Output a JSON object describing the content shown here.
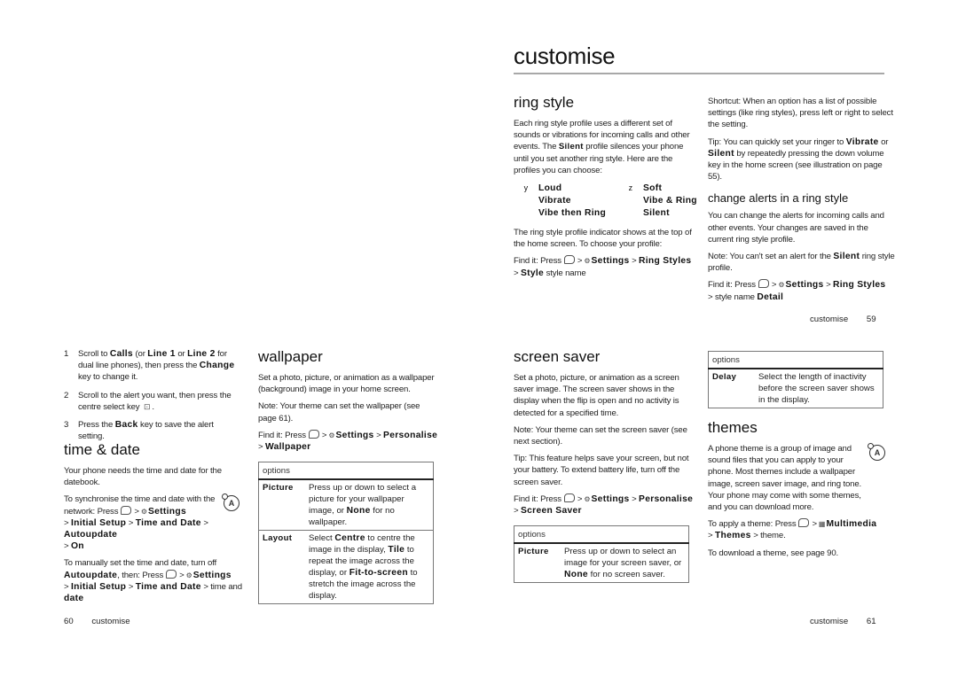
{
  "page_right_top": {
    "title": "customise",
    "ring_style": {
      "heading": "ring style",
      "intro_pre": "Each ring style profile uses a different set of sounds or vibrations for incoming calls and other events. The ",
      "intro_bold": "Silent",
      "intro_post": " profile silences your phone until you set another ring style. Here are the profiles you can choose:",
      "profiles": [
        {
          "marker": "y",
          "label": "Loud"
        },
        {
          "marker": "z",
          "label": "Soft"
        },
        {
          "marker": "",
          "label": "Vibrate"
        },
        {
          "marker": "",
          "label": "Vibe & Ring"
        },
        {
          "marker": "",
          "label": "Vibe then Ring"
        },
        {
          "marker": "",
          "label": "Silent"
        }
      ],
      "indicator_text": "The ring style profile indicator shows at the top of the home screen. To choose your profile:",
      "find_it": {
        "prefix": "Find it:  Press",
        "sep": ">",
        "settings": "Settings",
        "path1": "Ring Styles",
        "path2": "Style",
        "tail": "style name"
      }
    },
    "shortcut": "Shortcut:  When an option has a list of possible settings (like ring styles), press left or right to select the setting.",
    "tip": {
      "pre": "Tip:  You can quickly set your ringer to ",
      "b1": "Vibrate",
      "mid": " or ",
      "b2": "Silent",
      "post": " by repeatedly pressing the down volume key in the home screen (see illustration on page 55)."
    },
    "change_alerts": {
      "heading": "change alerts in a ring style",
      "body": "You can change the alerts for incoming calls and other events. Your changes are saved in the current ring style profile.",
      "note_pre": "Note:  You can't set an alert for the ",
      "note_bold": "Silent",
      "note_post": " ring style profile.",
      "find_it": {
        "prefix": "Find it:  Press",
        "sep": ">",
        "settings": "Settings",
        "path1": "Ring Styles",
        "tail": "style name",
        "path2": "Detail"
      }
    },
    "footer": {
      "label": "customise",
      "page": "59"
    }
  },
  "page_left_bottom": {
    "steps": [
      {
        "n": "1",
        "pre": "Scroll to ",
        "b1": "Calls",
        "m1": " (or ",
        "b2": "Line 1",
        "m2": " or ",
        "b3": "Line 2",
        "m3": " for dual line phones), then press the ",
        "b4": "Change",
        "post": " key to change it."
      },
      {
        "n": "2",
        "text": "Scroll to the alert you want, then press the centre select key",
        "icon": "⊡"
      },
      {
        "n": "3",
        "pre": "Press the ",
        "b1": "Back",
        "post": " key to save the alert setting."
      }
    ],
    "time_date": {
      "heading": "time & date",
      "body": "Your phone needs the time and date for the datebook.",
      "sync_pre": "To synchronise  the time and date with the network: Press",
      "settings": "Settings",
      "sync_path": [
        "Initial Setup",
        "Time and Date",
        "Autoupdate",
        "On"
      ],
      "manual_pre": "To manually  set the time and date, turn off ",
      "manual_bold": "Autoupdate",
      "manual_mid": ", then: Press",
      "manual_path": [
        "Initial Setup",
        "Time and Date",
        "time",
        "date"
      ],
      "sep": ">"
    },
    "wallpaper": {
      "heading": "wallpaper",
      "body": "Set a photo, picture,  or animation as a wallpaper (background) image in your home screen.",
      "note": "Note:  Your theme can set the wallpaper (see page 61).",
      "find_prefix": "Find it:  Press",
      "settings": "Settings",
      "path": [
        "Personalise",
        "Wallpaper"
      ],
      "sep": ">",
      "table": {
        "header": "options",
        "rows": [
          {
            "key": "Picture",
            "desc_pre": "Press     up or down to select a picture for your wallpaper image, or ",
            "desc_bold": "None",
            "desc_post": " for no wallpaper."
          },
          {
            "key": "Layout",
            "desc_pre": "Select ",
            "b1": "Centre",
            "m1": " to centre the image in the display, ",
            "b2": "Tile",
            "m2": " to repeat the image across the display, or ",
            "b3": "Fit-to-screen",
            "post": " to stretch the image across the display."
          }
        ]
      }
    },
    "footer": {
      "page": "60",
      "label": "customise"
    }
  },
  "page_right_bottom": {
    "screen_saver": {
      "heading": "screen saver",
      "body": "Set a photo, picture, or animation as a screen saver image. The screen saver shows in the display when the flip is open and no activity is detected for a specified time.",
      "note": "Note:  Your theme can set the screen saver (see next section).",
      "tip": "Tip:  This feature helps save your screen, but not your battery. To extend battery life, turn off the screen saver.",
      "find_prefix": "Find it:  Press",
      "settings": "Settings",
      "path": [
        "Personalise",
        "Screen Saver"
      ],
      "sep": ">",
      "table": {
        "header": "options",
        "rows": [
          {
            "key": "Picture",
            "desc_pre": "Press     up or down to select an image for your screen saver, or ",
            "desc_bold": "None",
            "desc_post": " for no screen saver."
          }
        ]
      }
    },
    "delay_table": {
      "header": "options",
      "rows": [
        {
          "key": "Delay",
          "desc": "Select the length of inactivity before the screen saver shows in the display."
        }
      ]
    },
    "themes": {
      "heading": "themes",
      "body": "A phone theme is a group of image and sound files that you can apply to your phone. Most themes include a wallpaper image, screen saver image, and ring tone. Your phone may come with some themes, and you can download more.",
      "apply_pre": "To apply  a theme: Press",
      "multimedia": "Multimedia",
      "path": [
        "Themes"
      ],
      "apply_tail": "theme.",
      "download": "To download  a theme, see page 90.",
      "sep": ">"
    },
    "footer": {
      "label": "customise",
      "page": "61"
    }
  }
}
